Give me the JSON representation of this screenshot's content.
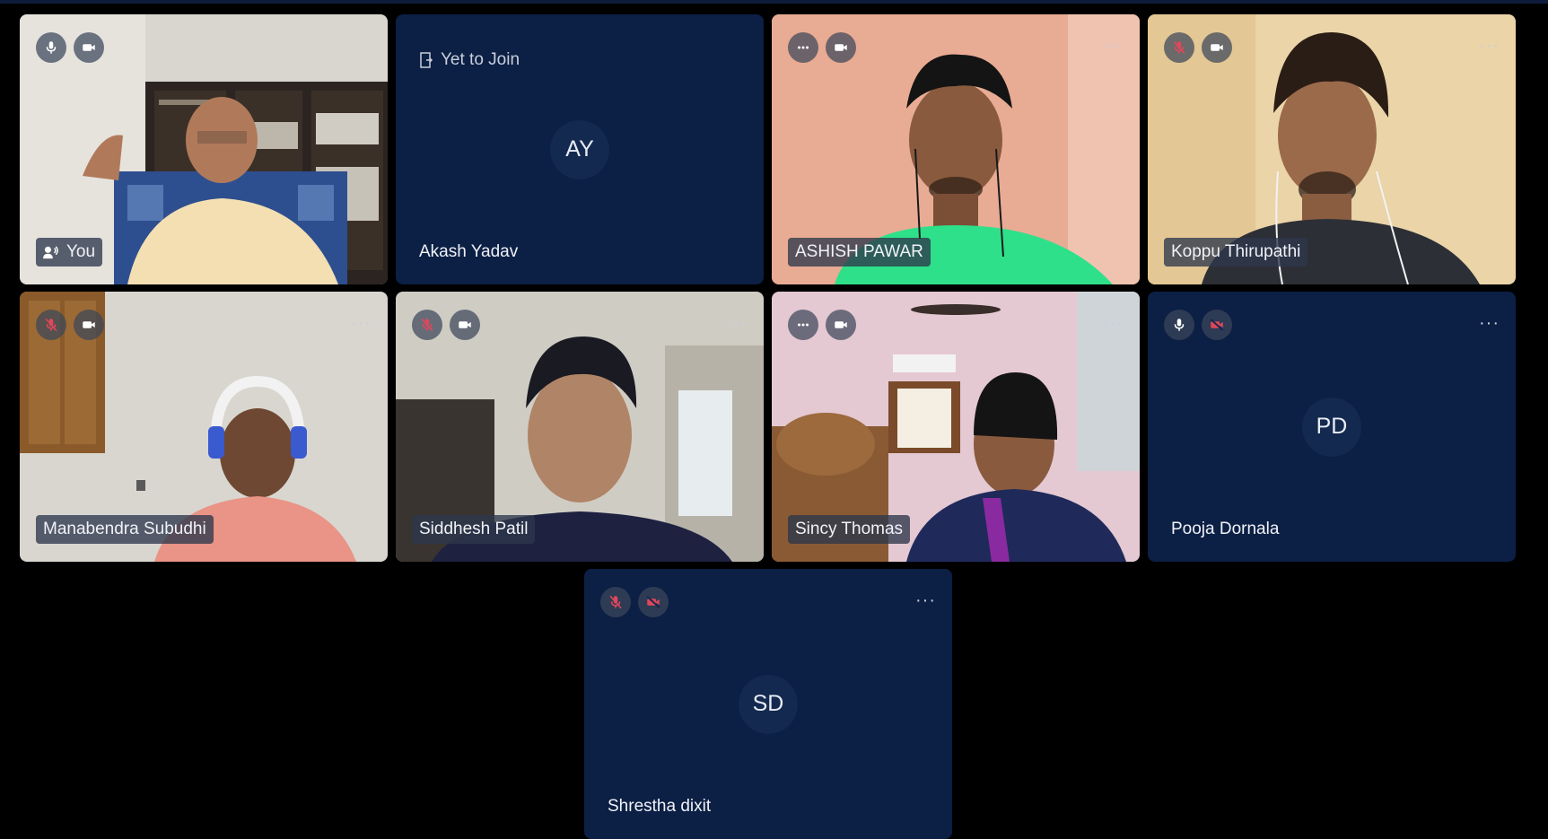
{
  "meeting": {
    "tiles": [
      {
        "name": "You",
        "mic": "on",
        "camera": "on",
        "speaking_icon": "speaker-icon"
      },
      {
        "name": "Akash Yadav",
        "status": "Yet to Join",
        "initials": "AY",
        "icon": "door-icon"
      },
      {
        "name": "ASHISH PAWAR",
        "mic": "more",
        "camera": "on",
        "menu": "···"
      },
      {
        "name": "Koppu Thirupathi",
        "mic": "muted",
        "camera": "on",
        "menu": "···"
      },
      {
        "name": "Manabendra Subudhi",
        "mic": "muted",
        "camera": "on",
        "menu": "···"
      },
      {
        "name": "Siddhesh Patil",
        "mic": "muted",
        "camera": "on",
        "menu": "···"
      },
      {
        "name": "Sincy Thomas",
        "mic": "more",
        "camera": "on",
        "menu": "···"
      },
      {
        "name": "Pooja Dornala",
        "initials": "PD",
        "mic": "on",
        "camera": "off",
        "menu": "···"
      },
      {
        "name": "Shrestha dixit",
        "initials": "SD",
        "mic": "muted",
        "camera": "off",
        "menu": "···"
      }
    ]
  },
  "colors": {
    "background": "#000000",
    "tile": "#0c1f44",
    "muted": "#e0475a",
    "button": "#3c465a"
  }
}
